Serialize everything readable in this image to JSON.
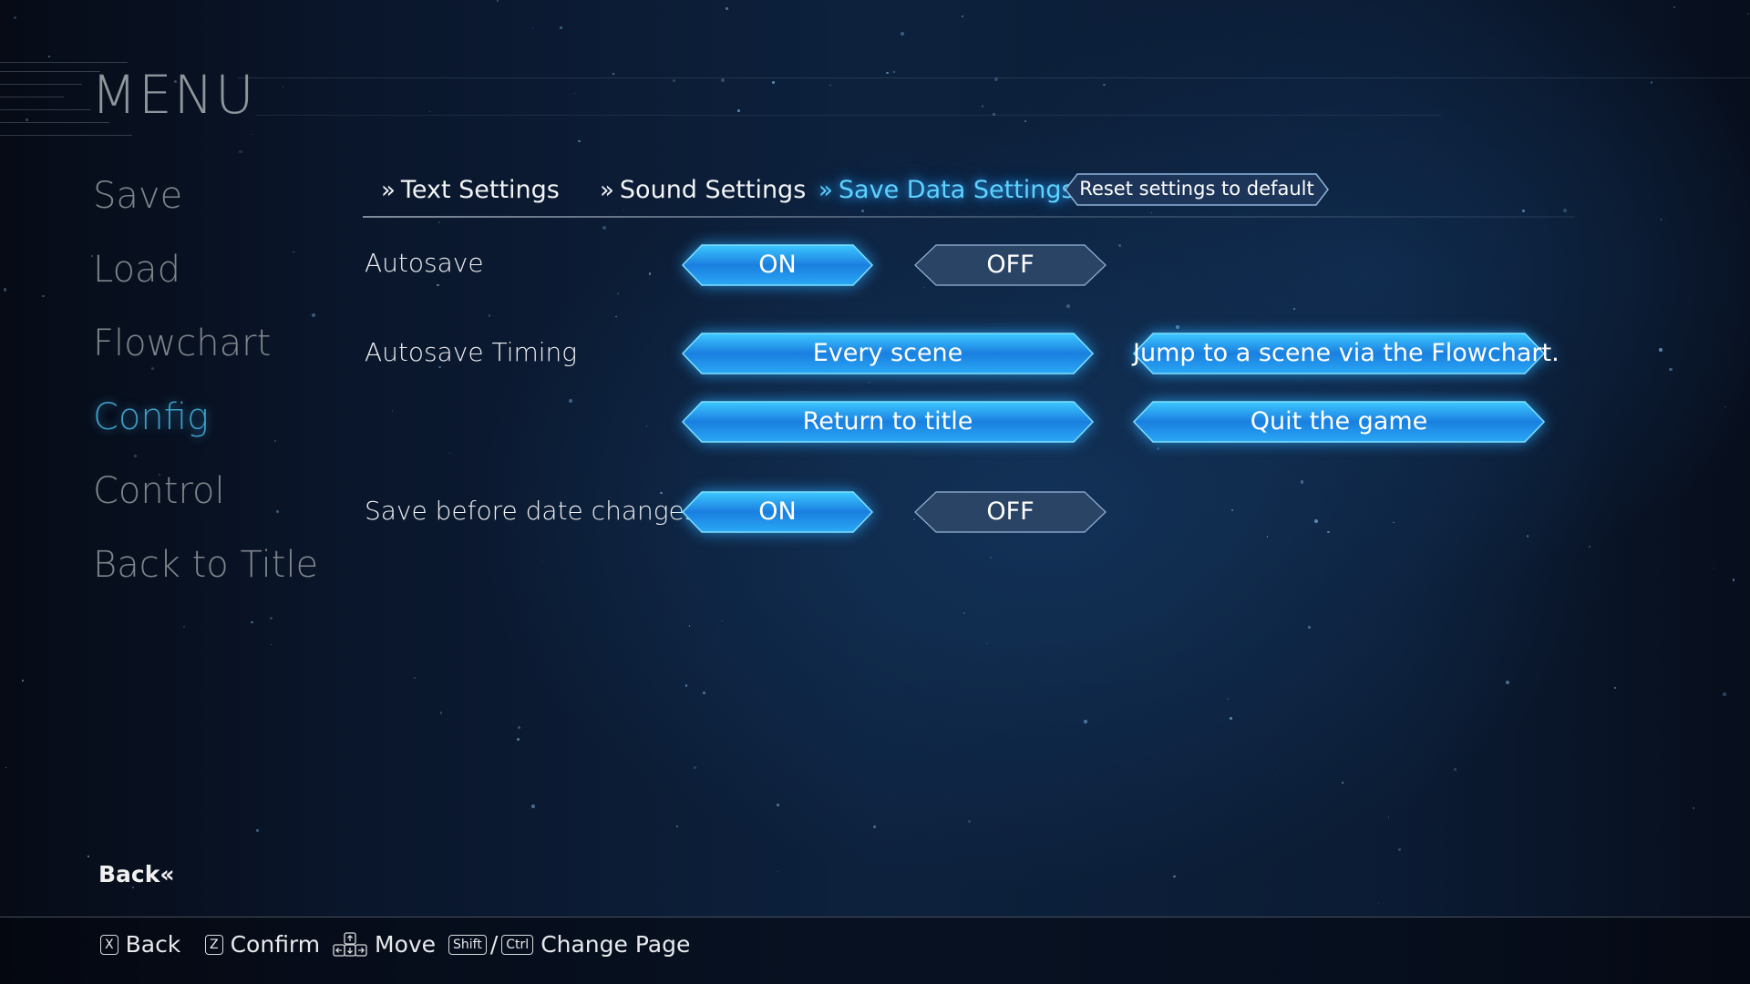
{
  "menu": {
    "title": "MENU"
  },
  "sidebar": {
    "items": [
      {
        "label": "Save",
        "active": false
      },
      {
        "label": "Load",
        "active": false
      },
      {
        "label": "Flowchart",
        "active": false
      },
      {
        "label": "Config",
        "active": true
      },
      {
        "label": "Control",
        "active": false
      },
      {
        "label": "Back to Title",
        "active": false
      }
    ]
  },
  "tabs": {
    "chevron": "»",
    "items": [
      {
        "label": "Text Settings",
        "active": false
      },
      {
        "label": "Sound Settings",
        "active": false
      },
      {
        "label": "Save Data Settings",
        "active": true
      }
    ],
    "reset_label": "Reset settings to default"
  },
  "settings": {
    "autosave": {
      "label": "Autosave",
      "on": "ON",
      "off": "OFF",
      "value": "ON"
    },
    "autosave_timing": {
      "label": "Autosave Timing",
      "options": [
        {
          "label": "Every scene",
          "selected": true
        },
        {
          "label": "Jump to a scene via the Flowchart.",
          "selected": true
        },
        {
          "label": "Return to title",
          "selected": true
        },
        {
          "label": "Quit the game",
          "selected": true
        }
      ]
    },
    "save_before_date": {
      "label": "Save before date changes",
      "on": "ON",
      "off": "OFF",
      "value": "ON"
    }
  },
  "back": {
    "label": "Back",
    "chevron": "«"
  },
  "footer": {
    "hints": [
      {
        "key": "X",
        "label": "Back"
      },
      {
        "key": "Z",
        "label": "Confirm"
      },
      {
        "key": "arrows",
        "label": "Move"
      },
      {
        "key": "Shift",
        "key2": "Ctrl",
        "separator": "/",
        "label": "Change Page"
      }
    ]
  },
  "colors": {
    "accent": "#5fd2ff",
    "active_sidebar": "#3b9ec5",
    "inactive_sidebar": "#7f858b",
    "button_on": "#1e8fe8",
    "button_off": "#2c4668"
  }
}
